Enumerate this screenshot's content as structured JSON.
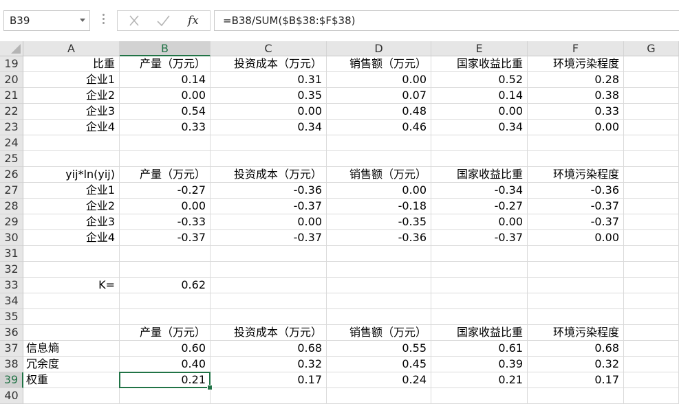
{
  "name_box": "B39",
  "formula": "=B38/SUM($B$38:$F$38)",
  "columns": [
    "A",
    "B",
    "C",
    "D",
    "E",
    "F",
    "G"
  ],
  "selected_column": "B",
  "selected_row": "39",
  "rows": [
    {
      "num": "19",
      "cells": [
        "比重",
        "产量（万元）",
        "投资成本（万元）",
        "销售额（万元）",
        "国家收益比重",
        "环境污染程度",
        ""
      ]
    },
    {
      "num": "20",
      "cells": [
        "企业1",
        "0.14",
        "0.31",
        "0.00",
        "0.52",
        "0.28",
        ""
      ]
    },
    {
      "num": "21",
      "cells": [
        "企业2",
        "0.00",
        "0.35",
        "0.07",
        "0.14",
        "0.38",
        ""
      ]
    },
    {
      "num": "22",
      "cells": [
        "企业3",
        "0.54",
        "0.00",
        "0.48",
        "0.00",
        "0.33",
        ""
      ]
    },
    {
      "num": "23",
      "cells": [
        "企业4",
        "0.33",
        "0.34",
        "0.46",
        "0.34",
        "0.00",
        ""
      ]
    },
    {
      "num": "24",
      "cells": [
        "",
        "",
        "",
        "",
        "",
        "",
        ""
      ]
    },
    {
      "num": "25",
      "cells": [
        "",
        "",
        "",
        "",
        "",
        "",
        ""
      ]
    },
    {
      "num": "26",
      "cells": [
        "yij*ln(yij)",
        "产量（万元）",
        "投资成本（万元）",
        "销售额（万元）",
        "国家收益比重",
        "环境污染程度",
        ""
      ]
    },
    {
      "num": "27",
      "cells": [
        "企业1",
        "-0.27",
        "-0.36",
        "0.00",
        "-0.34",
        "-0.36",
        ""
      ]
    },
    {
      "num": "28",
      "cells": [
        "企业2",
        "0.00",
        "-0.37",
        "-0.18",
        "-0.27",
        "-0.37",
        ""
      ]
    },
    {
      "num": "29",
      "cells": [
        "企业3",
        "-0.33",
        "0.00",
        "-0.35",
        "0.00",
        "-0.37",
        ""
      ]
    },
    {
      "num": "30",
      "cells": [
        "企业4",
        "-0.37",
        "-0.37",
        "-0.36",
        "-0.37",
        "0.00",
        ""
      ]
    },
    {
      "num": "31",
      "cells": [
        "",
        "",
        "",
        "",
        "",
        "",
        ""
      ]
    },
    {
      "num": "32",
      "cells": [
        "",
        "",
        "",
        "",
        "",
        "",
        ""
      ]
    },
    {
      "num": "33",
      "cells": [
        "K=",
        "0.62",
        "",
        "",
        "",
        "",
        ""
      ]
    },
    {
      "num": "34",
      "cells": [
        "",
        "",
        "",
        "",
        "",
        "",
        ""
      ]
    },
    {
      "num": "35",
      "cells": [
        "",
        "",
        "",
        "",
        "",
        "",
        ""
      ]
    },
    {
      "num": "36",
      "cells": [
        "",
        "产量（万元）",
        "投资成本（万元）",
        "销售额（万元）",
        "国家收益比重",
        "环境污染程度",
        ""
      ]
    },
    {
      "num": "37",
      "cells": [
        "信息熵",
        "0.60",
        "0.68",
        "0.55",
        "0.61",
        "0.68",
        ""
      ]
    },
    {
      "num": "38",
      "cells": [
        "冗余度",
        "0.40",
        "0.32",
        "0.45",
        "0.39",
        "0.32",
        ""
      ]
    },
    {
      "num": "39",
      "cells": [
        "权重",
        "0.21",
        "0.17",
        "0.24",
        "0.21",
        "0.17",
        ""
      ]
    },
    {
      "num": "40",
      "cells": [
        "",
        "",
        "",
        "",
        "",
        "",
        ""
      ]
    }
  ]
}
